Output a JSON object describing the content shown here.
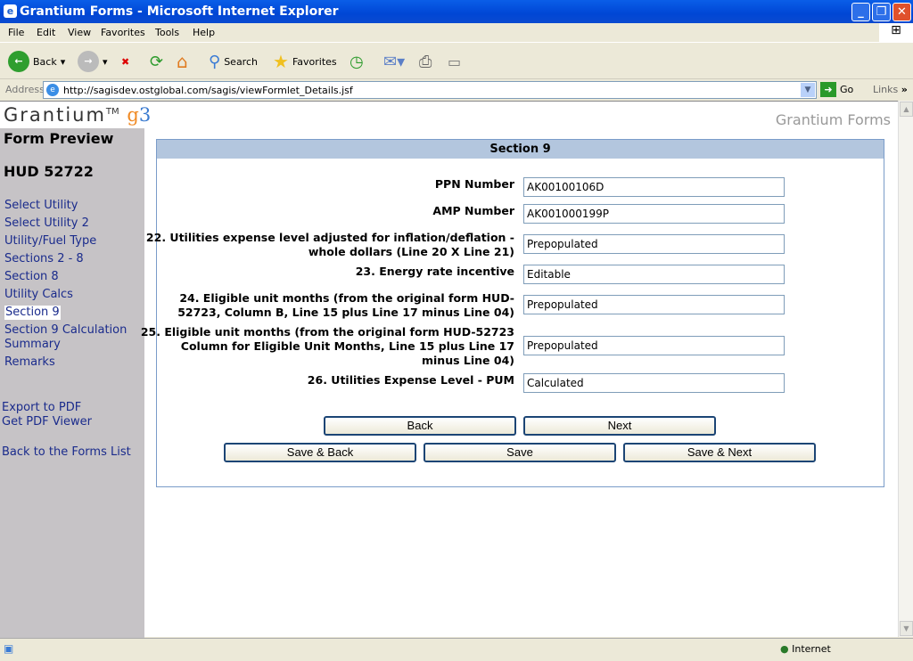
{
  "window": {
    "title": "Grantium Forms - Microsoft Internet Explorer"
  },
  "menu": [
    "File",
    "Edit",
    "View",
    "Favorites",
    "Tools",
    "Help"
  ],
  "toolbar": {
    "back": "Back",
    "search": "Search",
    "favorites": "Favorites"
  },
  "address": {
    "label": "Address",
    "url": "http://sagisdev.ostglobal.com/sagis/viewFormlet_Details.jsf",
    "go": "Go",
    "links": "Links"
  },
  "header": {
    "logo": "Grantium",
    "tm": "TM",
    "logo_g": "g",
    "logo_3": "3",
    "brand": "Grantium Forms"
  },
  "sidebar": {
    "title": "Form Preview",
    "form": "HUD 52722",
    "items": [
      "Select Utility",
      "Select Utility 2",
      "Utility/Fuel Type",
      "Sections 2 - 8",
      "Section 8",
      "Utility Calcs",
      "Section 9",
      "Section 9 Calculation Summary",
      "Remarks"
    ],
    "export": "Export to PDF",
    "viewer": "Get PDF Viewer",
    "back": "Back to the Forms List"
  },
  "section": {
    "title": "Section 9",
    "fields": [
      {
        "label": "PPN Number",
        "value": "AK00100106D"
      },
      {
        "label": "AMP Number",
        "value": "AK001000199P"
      },
      {
        "label": "22. Utilities expense level adjusted for inflation/deflation - whole dollars (Line 20 X Line 21)",
        "value": "Prepopulated"
      },
      {
        "label": "23. Energy rate incentive",
        "value": "Editable"
      },
      {
        "label": "24. Eligible unit months (from the original form HUD-52723, Column B, Line 15 plus Line 17 minus Line 04)",
        "value": "Prepopulated"
      },
      {
        "label": "25. Eligible unit months (from the original form HUD-52723 Column for Eligible Unit Months, Line 15 plus Line 17 minus Line 04)",
        "value": "Prepopulated"
      },
      {
        "label": "26. Utilities Expense Level - PUM",
        "value": "Calculated"
      }
    ]
  },
  "buttons": {
    "back": "Back",
    "next": "Next",
    "save_back": "Save & Back",
    "save": "Save",
    "save_next": "Save & Next"
  },
  "status": {
    "zone": "Internet"
  }
}
